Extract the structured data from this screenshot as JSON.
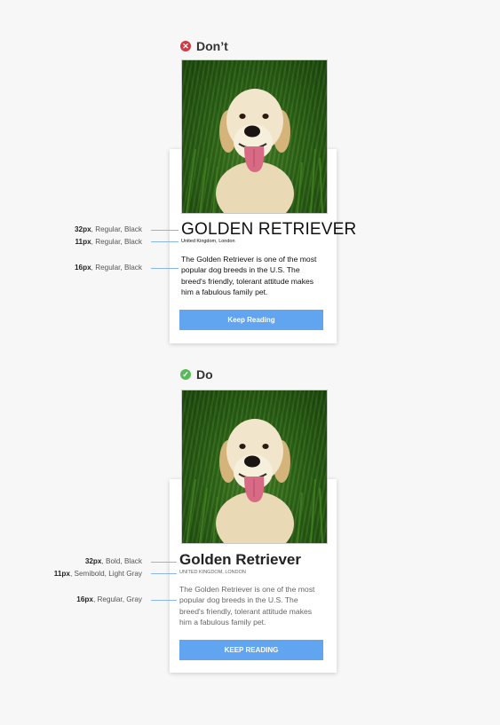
{
  "dont": {
    "heading": "Don’t",
    "title": "GOLDEN RETRIEVER",
    "subtitle": "United Kingdom, London",
    "body": "The Golden Retriever is one of the most popular dog breeds in the U.S. The breed's friendly, tolerant attitude makes him a fabulous family pet.",
    "button": "Keep Reading",
    "annotations": [
      {
        "size": "32px",
        "desc": ", Regular, Black"
      },
      {
        "size": "11px",
        "desc": ", Regular, Black"
      },
      {
        "size": "16px",
        "desc": ", Regular, Black"
      }
    ]
  },
  "do": {
    "heading": "Do",
    "title": "Golden Retriever",
    "subtitle": "UNITED KINGDOM, LONDON",
    "body": "The Golden Retriever is one of the most popular dog breeds in the U.S. The breed's friendly, tolerant attitude makes him a fabulous family pet.",
    "button": "KEEP READING",
    "annotations": [
      {
        "size": "32px",
        "desc": ", Bold, Black"
      },
      {
        "size": "11px",
        "desc": ", Semibold, Light Gray"
      },
      {
        "size": "16px",
        "desc": ", Regular, Gray"
      }
    ]
  },
  "icons": {
    "dont_badge": "x-circle-icon",
    "do_badge": "check-circle-icon"
  },
  "colors": {
    "accent": "#61a4ef",
    "bad": "#cf3a45",
    "good": "#5cb85c",
    "annotation_line": "#8ab6e6"
  }
}
